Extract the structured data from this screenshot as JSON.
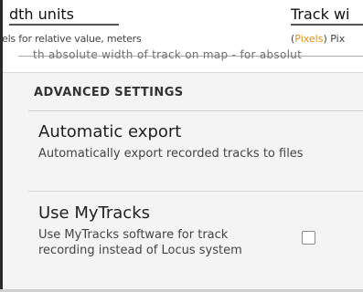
{
  "top_fragment": {
    "title_left": "dth units",
    "title_right": "Track wi",
    "subtitle_left": "els for relative value, meters",
    "subtitle_right_prefix": "(",
    "subtitle_right_accent": "Pixels",
    "subtitle_right_suffix": ") Pix",
    "ghost_text": "th absolute width of track on map - for absolut"
  },
  "settings": {
    "section_header": "ADVANCED SETTINGS",
    "automatic_export": {
      "title": "Automatic export",
      "summary": "Automatically export recorded tracks to files"
    },
    "use_mytracks": {
      "title": "Use MyTracks",
      "summary": "Use MyTracks software for track recording instead of Locus system",
      "checked": false
    }
  },
  "colors": {
    "accent": "#e8901a",
    "background": "#f4f4f4"
  }
}
